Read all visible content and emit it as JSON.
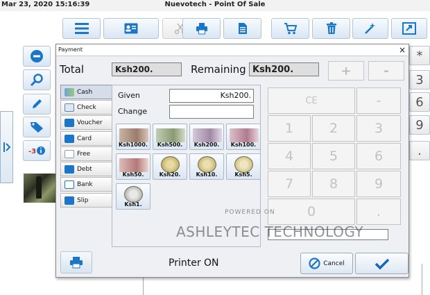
{
  "window": {
    "clock": "Mar 23, 2020 15:16:39",
    "title": "Nuevotech - Point Of Sale"
  },
  "colors": {
    "accent": "#1f7fd4",
    "toolbar_icon": "#1a76c8",
    "ok_check": "#1565c0"
  },
  "toolbar": {
    "icons": [
      "menu-icon",
      "customer-card-icon",
      "scissors-icon",
      "printer-icon",
      "document-icon",
      "cart-icon",
      "trash-icon",
      "wand-icon",
      "expand-icon"
    ]
  },
  "side_buttons": [
    "minus-circle-icon",
    "search-icon",
    "pencil-icon",
    "tag-icon",
    "discount-icon"
  ],
  "right_keys": [
    "*",
    "3",
    "6",
    "9",
    "."
  ],
  "dialog": {
    "title": "Payment",
    "close": "×",
    "total_label": "Total",
    "total_value": "Ksh200.",
    "remaining_label": "Remaining",
    "remaining_value": "Ksh200.",
    "plus": "+",
    "minus": "-",
    "tabs": [
      {
        "label": "Cash",
        "icon": "cash-icon"
      },
      {
        "label": "Check",
        "icon": "check-icon"
      },
      {
        "label": "Voucher",
        "icon": "voucher-icon"
      },
      {
        "label": "Card",
        "icon": "card-icon"
      },
      {
        "label": "Free",
        "icon": "free-icon"
      },
      {
        "label": "Debt",
        "icon": "debt-icon"
      },
      {
        "label": "Bank",
        "icon": "bank-icon"
      },
      {
        "label": "Slip",
        "icon": "slip-icon"
      }
    ],
    "given_label": "Given",
    "given_value": "Ksh200.",
    "change_label": "Change",
    "change_value": "",
    "denominations": [
      {
        "label": "Ksh1000.",
        "kind": "note",
        "color": "#9c7b6a"
      },
      {
        "label": "Ksh500.",
        "kind": "note",
        "color": "#8a9a72"
      },
      {
        "label": "Ksh200.",
        "kind": "note",
        "color": "#a08aa6"
      },
      {
        "label": "Ksh100.",
        "kind": "note",
        "color": "#b07b8e"
      },
      {
        "label": "Ksh50.",
        "kind": "note",
        "color": "#b37a76"
      },
      {
        "label": "Ksh20.",
        "kind": "coin",
        "color": "#c7b36a"
      },
      {
        "label": "Ksh10.",
        "kind": "coin",
        "color": "#c9b877"
      },
      {
        "label": "Ksh5.",
        "kind": "coin",
        "color": "#d1c38a"
      },
      {
        "label": "Ksh1.",
        "kind": "coin",
        "color": "#c8c8c8"
      }
    ],
    "keypad": {
      "ce": "CE",
      "minus": "-",
      "digits": [
        "1",
        "2",
        "3",
        "4",
        "5",
        "6",
        "7",
        "8",
        "9"
      ],
      "zero": "0",
      "dot": "."
    },
    "printer_status": "Printer ON",
    "cancel_label": "Cancel"
  },
  "watermark": {
    "small": "POWERED ON",
    "large": "ASHLEYTEC TECHNOLOGY"
  }
}
